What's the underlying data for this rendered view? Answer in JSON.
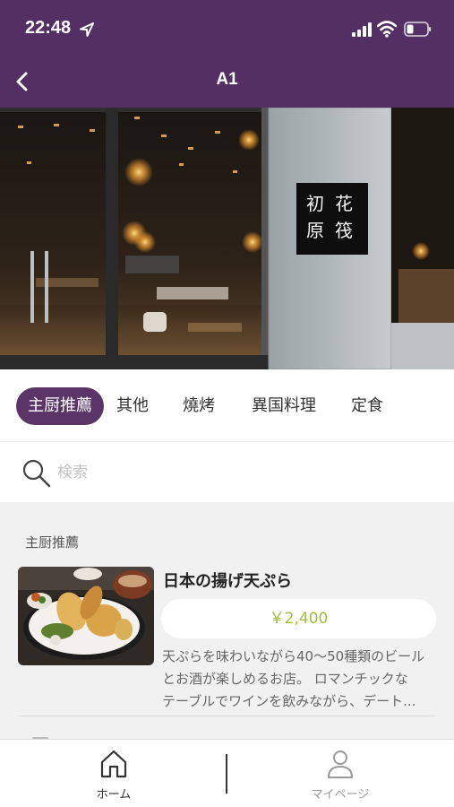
{
  "status_bar": {
    "time": "22:48"
  },
  "nav": {
    "title": "A1"
  },
  "hero": {
    "sign_text": "初原花筏"
  },
  "categories": [
    {
      "label": "主厨推薦",
      "active": true
    },
    {
      "label": "其他",
      "active": false
    },
    {
      "label": "燒烤",
      "active": false
    },
    {
      "label": "異国料理",
      "active": false
    },
    {
      "label": "定食",
      "active": false
    }
  ],
  "search": {
    "placeholder": "検索"
  },
  "section": {
    "title": "主厨推薦",
    "items": [
      {
        "name": "日本の揚げ天ぷら",
        "price": "￥2,400",
        "description_lines": [
          "天ぷらを味わいながら40～50種類のビール",
          "とお酒が楽しめるお店。 ロマンチックな",
          "テーブルでワインを飲みながら、デート..."
        ]
      }
    ]
  },
  "tabbar": {
    "home_label": "ホーム",
    "mypage_label": "マイページ"
  },
  "colors": {
    "header_bg": "#532f64",
    "active_tab_bg": "#5b3568",
    "price_text": "#9fbf3a"
  },
  "icons": [
    "location-arrow-icon",
    "signal-icon",
    "wifi-icon",
    "battery-icon",
    "back-chevron-icon",
    "search-icon",
    "home-icon",
    "user-icon"
  ]
}
